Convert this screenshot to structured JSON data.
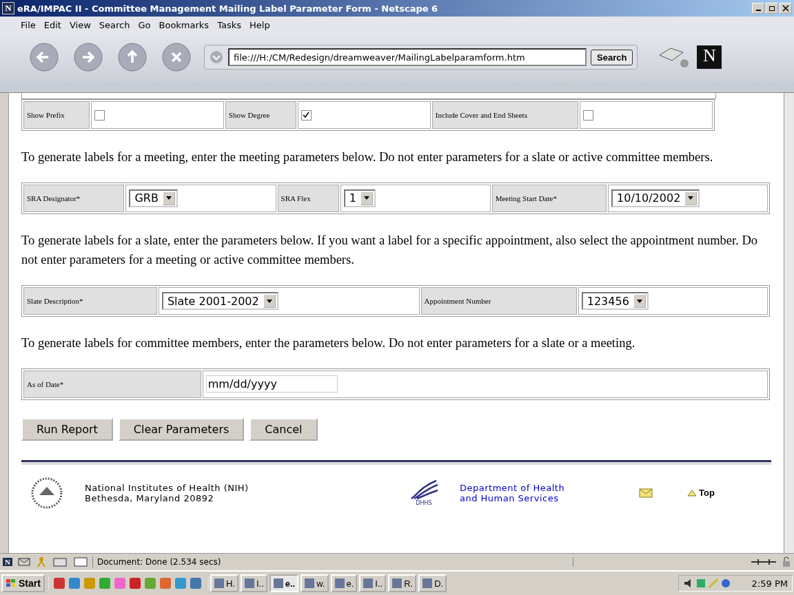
{
  "window": {
    "icon_letter": "N",
    "title": "eRA/IMPAC II - Committee Management Mailing Label Parameter Form - Netscape 6"
  },
  "menu": [
    "File",
    "Edit",
    "View",
    "Search",
    "Go",
    "Bookmarks",
    "Tasks",
    "Help"
  ],
  "toolbar": {
    "logo_letter": "N",
    "url": "file:///H:/CM/Redesign/dreamweaver/MailingLabelparamform.htm",
    "search_button": "Search"
  },
  "checkbox_row": [
    {
      "label": "Show Prefix",
      "checked": false
    },
    {
      "label": "Show Degree",
      "checked": true
    },
    {
      "label": "Include Cover and End Sheets",
      "checked": false
    }
  ],
  "sections": [
    {
      "instructions": "To generate labels for a meeting, enter the meeting parameters below. Do not enter parameters for a slate or active committee members.",
      "fields": [
        {
          "label": "SRA Designator*",
          "kind": "select",
          "value": "GRB"
        },
        {
          "label": "SRA Flex",
          "kind": "select",
          "value": "1"
        },
        {
          "label": "Meeting Start Date*",
          "kind": "select",
          "value": "10/10/2002"
        }
      ]
    },
    {
      "instructions": "To generate labels for a slate, enter the parameters below. If you want a label for a specific appointment, also select the appointment number. Do not enter parameters for a meeting or active committee members.",
      "fields": [
        {
          "label": "Slate Description*",
          "kind": "select",
          "value": "Slate 2001-2002"
        },
        {
          "label": "Appointment Number",
          "kind": "select",
          "value": "123456"
        }
      ]
    },
    {
      "instructions": "To generate labels for committee members, enter the parameters below. Do not enter parameters for a slate or a meeting.",
      "fields": [
        {
          "label": "As of Date*",
          "kind": "text",
          "value": "mm/dd/yyyy"
        }
      ]
    }
  ],
  "buttons": [
    "Run Report",
    "Clear Parameters",
    "Cancel"
  ],
  "footer": {
    "org": [
      "National Institutes of Health (NIH)",
      "Bethesda, Maryland 20892"
    ],
    "dhhs_label": "DHHS",
    "dept": [
      "Department of Health",
      "and Human Services"
    ],
    "top_link": "Top"
  },
  "status": "Document: Done (2.534 secs)",
  "status_icon_letter": "N",
  "taskbar": {
    "start": "Start",
    "tasks": [
      "H.",
      "I..",
      "e..",
      "w.",
      "e.",
      "I..",
      "R.",
      "D."
    ],
    "clock": "2:59 PM"
  }
}
